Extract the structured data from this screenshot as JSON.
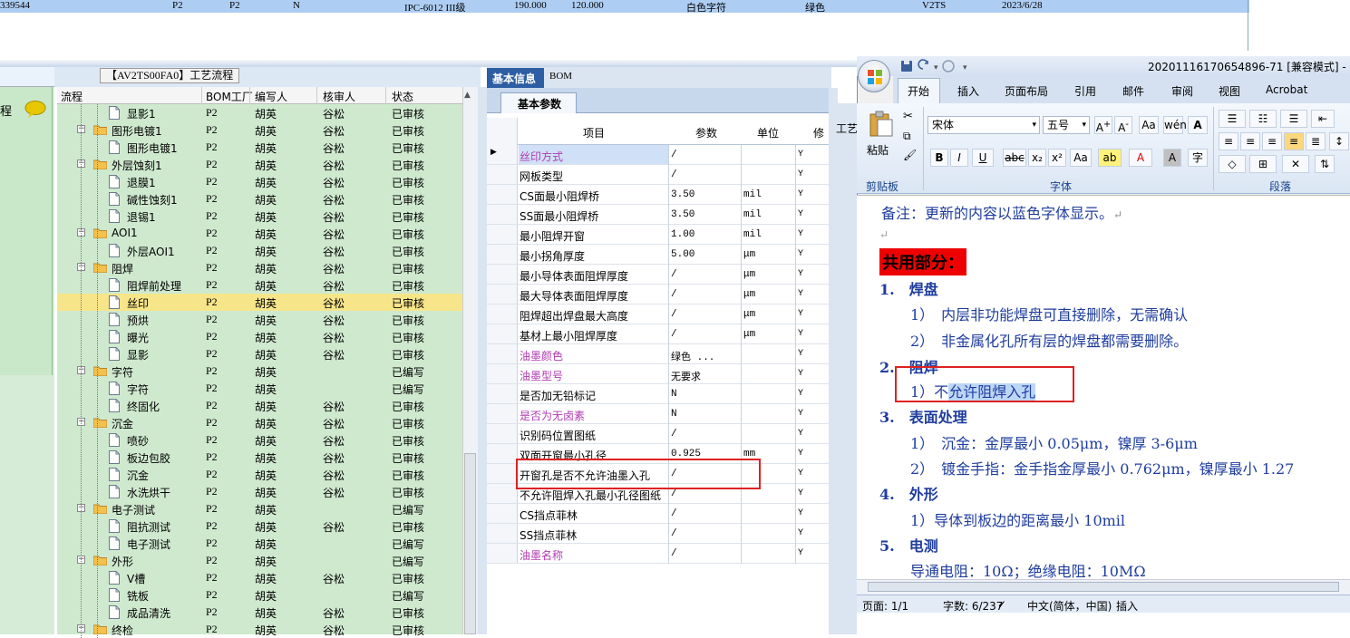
{
  "top_row": [
    "339544",
    "P2",
    "P2",
    "N",
    "IPC-6012 III级",
    "190.000",
    "120.000",
    "白色字符",
    "绿色",
    "V2TS",
    "2023/6/28"
  ],
  "left_panel": {
    "label": "程"
  },
  "flow": {
    "title": "【AV2TS00FA0】工艺流程",
    "headers": [
      "流程",
      "BOM工厂",
      "编写人",
      "核审人",
      "状态"
    ],
    "rows": [
      {
        "name": "显影1",
        "factory": "P2",
        "writer": "胡英",
        "reviewer": "谷松",
        "status": "已审核",
        "level": 2
      },
      {
        "name": "图形电镀1",
        "factory": "P2",
        "writer": "胡英",
        "reviewer": "谷松",
        "status": "已审核",
        "level": 1
      },
      {
        "name": "图形电镀1",
        "factory": "P2",
        "writer": "胡英",
        "reviewer": "谷松",
        "status": "已审核",
        "level": 2
      },
      {
        "name": "外层蚀刻1",
        "factory": "P2",
        "writer": "胡英",
        "reviewer": "谷松",
        "status": "已审核",
        "level": 1
      },
      {
        "name": "退膜1",
        "factory": "P2",
        "writer": "胡英",
        "reviewer": "谷松",
        "status": "已审核",
        "level": 2
      },
      {
        "name": "碱性蚀刻1",
        "factory": "P2",
        "writer": "胡英",
        "reviewer": "谷松",
        "status": "已审核",
        "level": 2
      },
      {
        "name": "退锡1",
        "factory": "P2",
        "writer": "胡英",
        "reviewer": "谷松",
        "status": "已审核",
        "level": 2
      },
      {
        "name": "AOI1",
        "factory": "P2",
        "writer": "胡英",
        "reviewer": "谷松",
        "status": "已审核",
        "level": 1
      },
      {
        "name": "外层AOI1",
        "factory": "P2",
        "writer": "胡英",
        "reviewer": "谷松",
        "status": "已审核",
        "level": 2
      },
      {
        "name": "阻焊",
        "factory": "P2",
        "writer": "胡英",
        "reviewer": "谷松",
        "status": "已审核",
        "level": 1
      },
      {
        "name": "阻焊前处理",
        "factory": "P2",
        "writer": "胡英",
        "reviewer": "谷松",
        "status": "已审核",
        "level": 2
      },
      {
        "name": "丝印",
        "factory": "P2",
        "writer": "胡英",
        "reviewer": "谷松",
        "status": "已审核",
        "level": 2,
        "selected": true
      },
      {
        "name": "预烘",
        "factory": "P2",
        "writer": "胡英",
        "reviewer": "谷松",
        "status": "已审核",
        "level": 2
      },
      {
        "name": "曝光",
        "factory": "P2",
        "writer": "胡英",
        "reviewer": "谷松",
        "status": "已审核",
        "level": 2
      },
      {
        "name": "显影",
        "factory": "P2",
        "writer": "胡英",
        "reviewer": "谷松",
        "status": "已审核",
        "level": 2
      },
      {
        "name": "字符",
        "factory": "P2",
        "writer": "胡英",
        "reviewer": "",
        "status": "已编写",
        "level": 1
      },
      {
        "name": "字符",
        "factory": "P2",
        "writer": "胡英",
        "reviewer": "",
        "status": "已编写",
        "level": 2
      },
      {
        "name": "终固化",
        "factory": "P2",
        "writer": "胡英",
        "reviewer": "谷松",
        "status": "已审核",
        "level": 2
      },
      {
        "name": "沉金",
        "factory": "P2",
        "writer": "胡英",
        "reviewer": "谷松",
        "status": "已审核",
        "level": 1
      },
      {
        "name": "喷砂",
        "factory": "P2",
        "writer": "胡英",
        "reviewer": "谷松",
        "status": "已审核",
        "level": 2
      },
      {
        "name": "板边包胶",
        "factory": "P2",
        "writer": "胡英",
        "reviewer": "谷松",
        "status": "已审核",
        "level": 2
      },
      {
        "name": "沉金",
        "factory": "P2",
        "writer": "胡英",
        "reviewer": "谷松",
        "status": "已审核",
        "level": 2
      },
      {
        "name": "水洗烘干",
        "factory": "P2",
        "writer": "胡英",
        "reviewer": "谷松",
        "status": "已审核",
        "level": 2
      },
      {
        "name": "电子测试",
        "factory": "P2",
        "writer": "胡英",
        "reviewer": "",
        "status": "已编写",
        "level": 1
      },
      {
        "name": "阻抗测试",
        "factory": "P2",
        "writer": "胡英",
        "reviewer": "谷松",
        "status": "已审核",
        "level": 2
      },
      {
        "name": "电子测试",
        "factory": "P2",
        "writer": "胡英",
        "reviewer": "",
        "status": "已编写",
        "level": 2
      },
      {
        "name": "外形",
        "factory": "P2",
        "writer": "胡英",
        "reviewer": "",
        "status": "已编写",
        "level": 1
      },
      {
        "name": "V槽",
        "factory": "P2",
        "writer": "胡英",
        "reviewer": "谷松",
        "status": "已审核",
        "level": 2
      },
      {
        "name": "铣板",
        "factory": "P2",
        "writer": "胡英",
        "reviewer": "",
        "status": "已编写",
        "level": 2
      },
      {
        "name": "成品清洗",
        "factory": "P2",
        "writer": "胡英",
        "reviewer": "谷松",
        "status": "已审核",
        "level": 2
      },
      {
        "name": "终检",
        "factory": "P2",
        "writer": "胡英",
        "reviewer": "谷松",
        "status": "已审核",
        "level": 1
      }
    ]
  },
  "basic": {
    "tab_basic": "基本信息",
    "tab_bom": "BOM",
    "subtab": "基本参数",
    "headers": [
      "项目",
      "参数",
      "单位",
      "修"
    ],
    "rows": [
      {
        "item": "丝印方式",
        "param": "/",
        "unit": "",
        "flag": "Y",
        "color": "#b03cb0"
      },
      {
        "item": "网板类型",
        "param": "/",
        "unit": "",
        "flag": "Y",
        "color": "#000000"
      },
      {
        "item": "CS面最小阻焊桥",
        "param": "3.50",
        "unit": "mil",
        "flag": "Y",
        "color": "#000000"
      },
      {
        "item": "SS面最小阻焊桥",
        "param": "3.50",
        "unit": "mil",
        "flag": "Y",
        "color": "#000000"
      },
      {
        "item": "最小阻焊开窗",
        "param": "1.00",
        "unit": "mil",
        "flag": "Y",
        "color": "#000000"
      },
      {
        "item": "最小拐角厚度",
        "param": "5.00",
        "unit": "μm",
        "flag": "Y",
        "color": "#000000"
      },
      {
        "item": "最小导体表面阻焊厚度",
        "param": "/",
        "unit": "μm",
        "flag": "Y",
        "color": "#000000"
      },
      {
        "item": "最大导体表面阻焊厚度",
        "param": "/",
        "unit": "μm",
        "flag": "Y",
        "color": "#000000"
      },
      {
        "item": "阻焊超出焊盘最大高度",
        "param": "/",
        "unit": "μm",
        "flag": "Y",
        "color": "#000000"
      },
      {
        "item": "基材上最小阻焊厚度",
        "param": "/",
        "unit": "μm",
        "flag": "Y",
        "color": "#000000"
      },
      {
        "item": "油墨颜色",
        "param": "绿色 ...",
        "unit": "",
        "flag": "Y",
        "color": "#b03cb0"
      },
      {
        "item": "油墨型号",
        "param": "无要求",
        "unit": "",
        "flag": "Y",
        "color": "#b03cb0"
      },
      {
        "item": "是否加无铅标记",
        "param": "N",
        "unit": "",
        "flag": "Y",
        "color": "#000000"
      },
      {
        "item": "是否为无卤素",
        "param": "N",
        "unit": "",
        "flag": "Y",
        "color": "#b03cb0"
      },
      {
        "item": "识别码位置图纸",
        "param": "/",
        "unit": "",
        "flag": "Y",
        "color": "#000000"
      },
      {
        "item": "双面开窗最小孔径",
        "param": "0.925",
        "unit": "mm",
        "flag": "Y",
        "color": "#000000"
      },
      {
        "item": "开窗孔是否不允许油墨入孔",
        "param": "/",
        "unit": "",
        "flag": "Y",
        "color": "#000000"
      },
      {
        "item": "不允许阻焊入孔最小孔径图纸",
        "param": "/",
        "unit": "",
        "flag": "Y",
        "color": "#000000"
      },
      {
        "item": "CS挡点菲林",
        "param": "/",
        "unit": "",
        "flag": "Y",
        "color": "#000000"
      },
      {
        "item": "SS挡点菲林",
        "param": "/",
        "unit": "",
        "flag": "Y",
        "color": "#000000"
      },
      {
        "item": "油墨名称",
        "param": "/",
        "unit": "",
        "flag": "Y",
        "color": "#b03cb0"
      }
    ]
  },
  "word": {
    "title": "20201116170654896-71 [兼容模式] - M",
    "tabs": [
      "开始",
      "插入",
      "页面布局",
      "引用",
      "邮件",
      "审阅",
      "视图",
      "Acrobat"
    ],
    "font_name": "宋体",
    "font_size": "五号",
    "paste_label": "粘贴",
    "groups": {
      "clipboard": "剪贴板",
      "font": "字体",
      "paragraph": "段落"
    },
    "side_tab": "工艺",
    "doc": {
      "note": "备注：更新的内容以蓝色字体显示。",
      "shared": "共用部分：",
      "h1": "1.　焊盘",
      "h1_1": "1）　内层非功能焊盘可直接删除，无需确认",
      "h1_2": "2）　非金属化孔所有层的焊盘都需要删除。",
      "h2": "2.　阻焊",
      "h2_1a": "1）不",
      "h2_1b": "允许阻焊入孔",
      "h3": "3.　表面处理",
      "h3_1": "1）　沉金：金厚最小 0.05μm，镍厚 3-6μm",
      "h3_2": "2）　镀金手指：金手指金厚最小 0.762μm，镍厚最小 1.27",
      "h4": "4.　外形",
      "h4_1": "1）导体到板边的距离最小 10mil",
      "h5": "5.　电测",
      "h5_1": "导通电阻：10Ω；绝缘电阻：10MΩ"
    },
    "status": {
      "page": "页面: 1/1",
      "words": "字数: 6/237",
      "lang": "中文(简体，中国)",
      "mode": "插入"
    }
  },
  "colors": {
    "flow_green": "#cfe9cf",
    "selection": "#f7e58a",
    "tab_blue": "#2d5ea3",
    "magenta": "#b03cb0",
    "doc_blue": "#1f3d9e"
  }
}
